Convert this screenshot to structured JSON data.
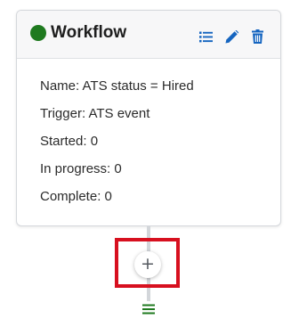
{
  "card": {
    "title": "Workflow",
    "status_color": "#1f7a1f",
    "actions": [
      {
        "icon": "list-icon"
      },
      {
        "icon": "pencil-icon"
      },
      {
        "icon": "trash-icon"
      }
    ],
    "fields": {
      "name": "Name: ATS status = Hired",
      "trigger": "Trigger: ATS event",
      "started": "Started: 0",
      "in_progress": "In progress: 0",
      "complete": "Complete: 0"
    }
  },
  "add_step": {
    "symbol": "+",
    "icon": "plus-icon"
  },
  "colors": {
    "accent": "#1565c0",
    "highlight": "#d7101f",
    "handle": "#1f7a1f"
  }
}
